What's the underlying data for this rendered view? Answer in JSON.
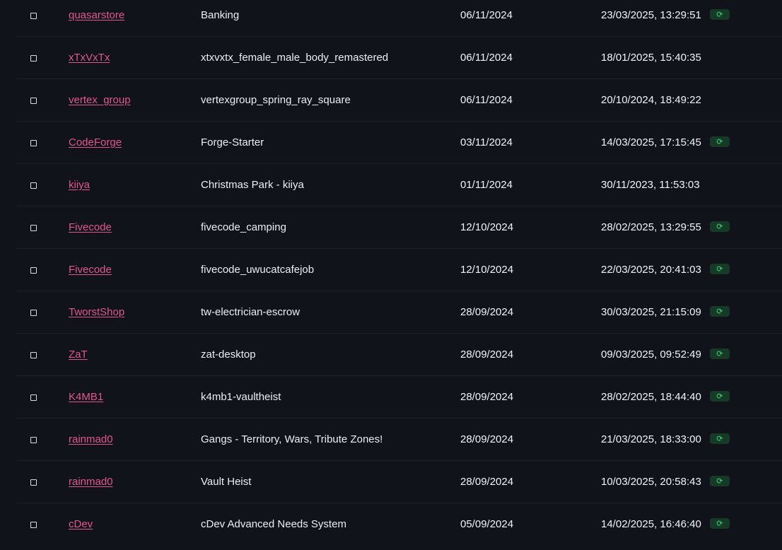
{
  "rows": [
    {
      "author": "quasarstore",
      "name": "Banking",
      "date": "06/11/2024",
      "updated": "23/03/2025, 13:29:51",
      "synced": true
    },
    {
      "author": "xTxVxTx",
      "name": "xtxvxtx_female_male_body_remastered",
      "date": "06/11/2024",
      "updated": "18/01/2025, 15:40:35",
      "synced": false
    },
    {
      "author": "vertex_group",
      "name": "vertexgroup_spring_ray_square",
      "date": "06/11/2024",
      "updated": "20/10/2024, 18:49:22",
      "synced": false
    },
    {
      "author": "CodeForge",
      "name": "Forge-Starter",
      "date": "03/11/2024",
      "updated": "14/03/2025, 17:15:45",
      "synced": true
    },
    {
      "author": "kiiya",
      "name": "Christmas Park - kiiya",
      "date": "01/11/2024",
      "updated": "30/11/2023, 11:53:03",
      "synced": false
    },
    {
      "author": "Fivecode",
      "name": "fivecode_camping",
      "date": "12/10/2024",
      "updated": "28/02/2025, 13:29:55",
      "synced": true
    },
    {
      "author": "Fivecode",
      "name": "fivecode_uwucatcafejob",
      "date": "12/10/2024",
      "updated": "22/03/2025, 20:41:03",
      "synced": true
    },
    {
      "author": "TworstShop",
      "name": "tw-electrician-escrow",
      "date": "28/09/2024",
      "updated": "30/03/2025, 21:15:09",
      "synced": true
    },
    {
      "author": "ZaT",
      "name": "zat-desktop",
      "date": "28/09/2024",
      "updated": "09/03/2025, 09:52:49",
      "synced": true
    },
    {
      "author": "K4MB1",
      "name": "k4mb1-vaultheist",
      "date": "28/09/2024",
      "updated": "28/02/2025, 18:44:40",
      "synced": true
    },
    {
      "author": "rainmad0",
      "name": "Gangs - Territory, Wars, Tribute Zones!",
      "date": "28/09/2024",
      "updated": "21/03/2025, 18:33:00",
      "synced": true
    },
    {
      "author": "rainmad0",
      "name": "Vault Heist",
      "date": "28/09/2024",
      "updated": "10/03/2025, 20:58:43",
      "synced": true
    },
    {
      "author": "cDev",
      "name": "cDev Advanced Needs System",
      "date": "05/09/2024",
      "updated": "14/02/2025, 16:46:40",
      "synced": true
    }
  ],
  "icons": {
    "checkbox": "checkbox-icon",
    "sync": "sync-icon",
    "sync_glyph": "⟳"
  },
  "colors": {
    "background": "#11131a",
    "author_link": "#e2578e",
    "sync_badge_bg": "#163a26",
    "sync_badge_fg": "#3fd47c"
  }
}
